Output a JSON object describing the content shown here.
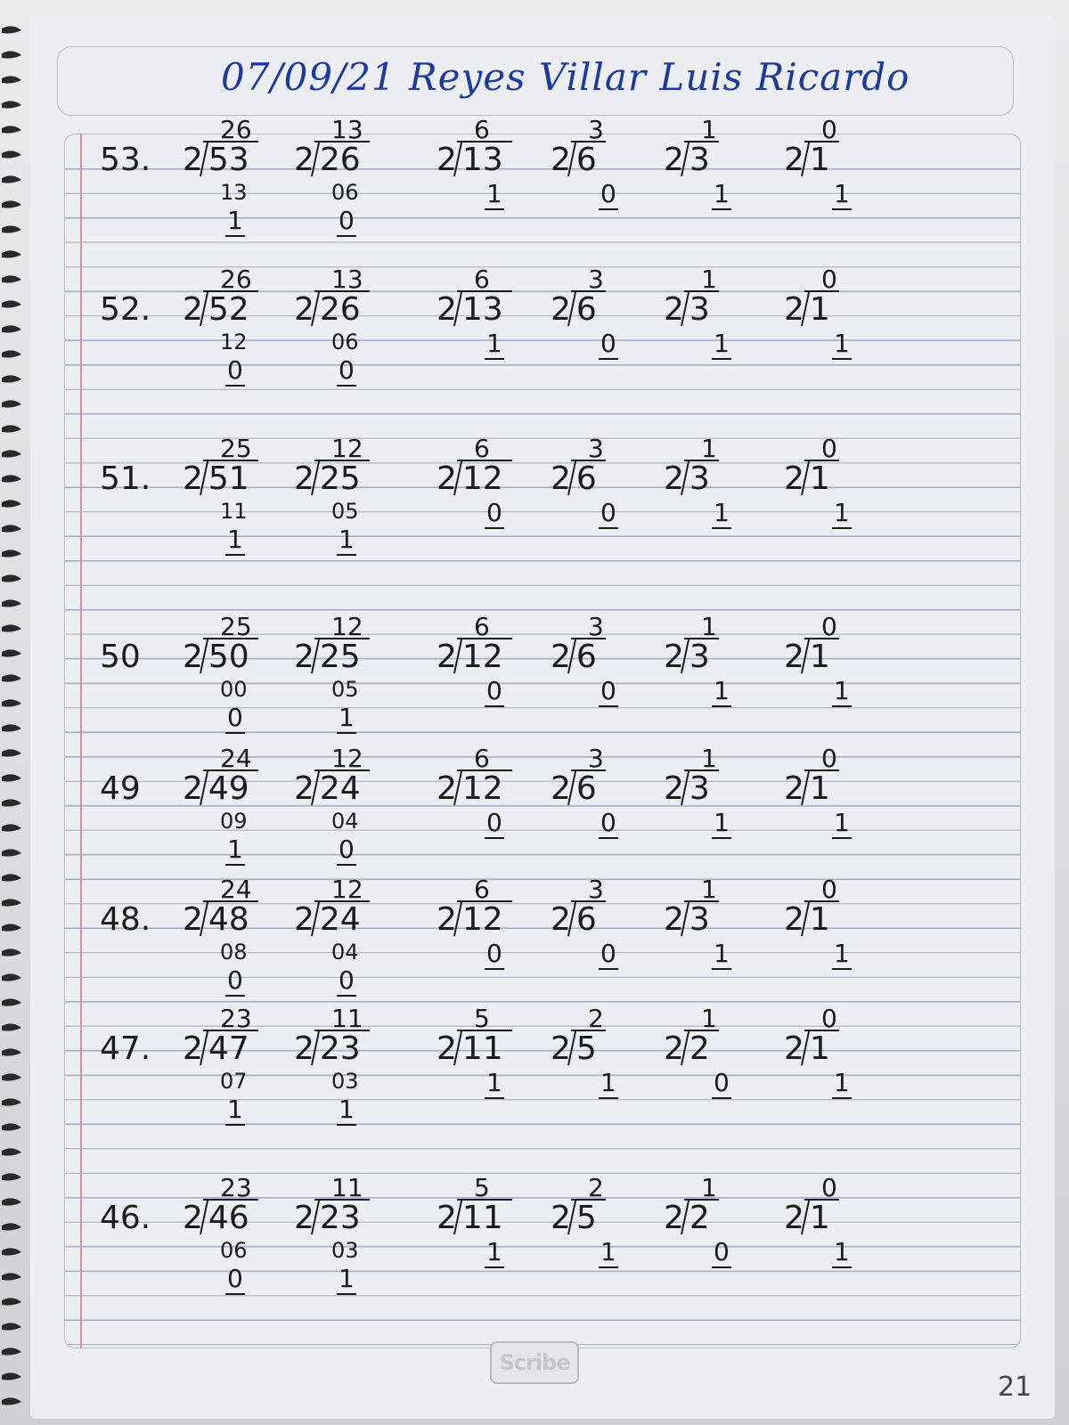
{
  "header": {
    "title": "07/09/21 Reyes Villar Luis Ricardo"
  },
  "logo_text": "Scribe",
  "page_number": "21",
  "problems": [
    {
      "label": "53.",
      "steps": [
        {
          "q": "26",
          "d": "53",
          "s": "13",
          "r": "1"
        },
        {
          "q": "13",
          "d": "26",
          "s": "06",
          "r": "0"
        },
        {
          "q": "6",
          "d": "13",
          "s": "",
          "r": "1"
        },
        {
          "q": "3",
          "d": "6",
          "s": "",
          "r": "0"
        },
        {
          "q": "1",
          "d": "3",
          "s": "",
          "r": "1"
        },
        {
          "q": "0",
          "d": "1",
          "s": "",
          "r": "1"
        }
      ]
    },
    {
      "label": "52.",
      "steps": [
        {
          "q": "26",
          "d": "52",
          "s": "12",
          "r": "0"
        },
        {
          "q": "13",
          "d": "26",
          "s": "06",
          "r": "0"
        },
        {
          "q": "6",
          "d": "13",
          "s": "",
          "r": "1"
        },
        {
          "q": "3",
          "d": "6",
          "s": "",
          "r": "0"
        },
        {
          "q": "1",
          "d": "3",
          "s": "",
          "r": "1"
        },
        {
          "q": "0",
          "d": "1",
          "s": "",
          "r": "1"
        }
      ]
    },
    {
      "label": "51.",
      "steps": [
        {
          "q": "25",
          "d": "51",
          "s": "11",
          "r": "1"
        },
        {
          "q": "12",
          "d": "25",
          "s": "05",
          "r": "1"
        },
        {
          "q": "6",
          "d": "12",
          "s": "",
          "r": "0"
        },
        {
          "q": "3",
          "d": "6",
          "s": "",
          "r": "0"
        },
        {
          "q": "1",
          "d": "3",
          "s": "",
          "r": "1"
        },
        {
          "q": "0",
          "d": "1",
          "s": "",
          "r": "1"
        }
      ]
    },
    {
      "label": "50",
      "steps": [
        {
          "q": "25",
          "d": "50",
          "s": "00",
          "r": "0"
        },
        {
          "q": "12",
          "d": "25",
          "s": "05",
          "r": "1"
        },
        {
          "q": "6",
          "d": "12",
          "s": "",
          "r": "0"
        },
        {
          "q": "3",
          "d": "6",
          "s": "",
          "r": "0"
        },
        {
          "q": "1",
          "d": "3",
          "s": "",
          "r": "1"
        },
        {
          "q": "0",
          "d": "1",
          "s": "",
          "r": "1"
        }
      ]
    },
    {
      "label": "49",
      "steps": [
        {
          "q": "24",
          "d": "49",
          "s": "09",
          "r": "1"
        },
        {
          "q": "12",
          "d": "24",
          "s": "04",
          "r": "0"
        },
        {
          "q": "6",
          "d": "12",
          "s": "",
          "r": "0"
        },
        {
          "q": "3",
          "d": "6",
          "s": "",
          "r": "0"
        },
        {
          "q": "1",
          "d": "3",
          "s": "",
          "r": "1"
        },
        {
          "q": "0",
          "d": "1",
          "s": "",
          "r": "1"
        }
      ]
    },
    {
      "label": "48.",
      "steps": [
        {
          "q": "24",
          "d": "48",
          "s": "08",
          "r": "0"
        },
        {
          "q": "12",
          "d": "24",
          "s": "04",
          "r": "0"
        },
        {
          "q": "6",
          "d": "12",
          "s": "",
          "r": "0"
        },
        {
          "q": "3",
          "d": "6",
          "s": "",
          "r": "0"
        },
        {
          "q": "1",
          "d": "3",
          "s": "",
          "r": "1"
        },
        {
          "q": "0",
          "d": "1",
          "s": "",
          "r": "1"
        }
      ]
    },
    {
      "label": "47.",
      "steps": [
        {
          "q": "23",
          "d": "47",
          "s": "07",
          "r": "1"
        },
        {
          "q": "11",
          "d": "23",
          "s": "03",
          "r": "1"
        },
        {
          "q": "5",
          "d": "11",
          "s": "",
          "r": "1"
        },
        {
          "q": "2",
          "d": "5",
          "s": "",
          "r": "1"
        },
        {
          "q": "1",
          "d": "2",
          "s": "",
          "r": "0"
        },
        {
          "q": "0",
          "d": "1",
          "s": "",
          "r": "1"
        }
      ]
    },
    {
      "label": "46.",
      "steps": [
        {
          "q": "23",
          "d": "46",
          "s": "06",
          "r": "0"
        },
        {
          "q": "11",
          "d": "23",
          "s": "03",
          "r": "1"
        },
        {
          "q": "5",
          "d": "11",
          "s": "",
          "r": "1"
        },
        {
          "q": "2",
          "d": "5",
          "s": "",
          "r": "1"
        },
        {
          "q": "1",
          "d": "2",
          "s": "",
          "r": "0"
        },
        {
          "q": "0",
          "d": "1",
          "s": "",
          "r": "1"
        }
      ]
    }
  ],
  "divisor": "2"
}
